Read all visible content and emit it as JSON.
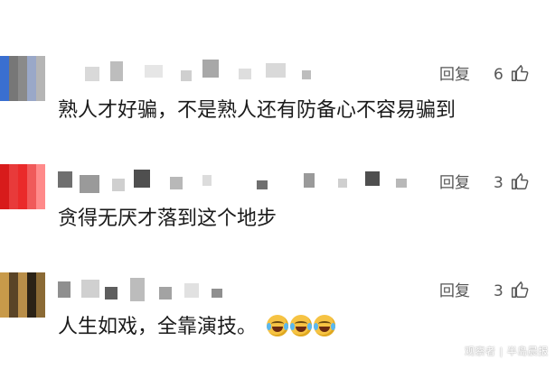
{
  "comments": [
    {
      "text": "熟人才好骗，不是熟人还有防备心不容易骗到",
      "reply_label": "回复",
      "likes": "6",
      "avatar_colors": [
        "#3a6fd0",
        "#9aa8c8",
        "#c9c9c9",
        "#777",
        "#b5b5b5",
        "#d8d8d8",
        "#8a8a8a",
        "#e5e5e5"
      ],
      "name_mosaic_colors": [
        "#d9d9d9",
        "#bdbdbd",
        "#e6e6e6",
        "#cfcfcf",
        "#a8a8a8",
        "#dedede"
      ]
    },
    {
      "text": "贪得无厌才落到这个地步",
      "reply_label": "回复",
      "likes": "3",
      "avatar_colors": [
        "#d81b1b",
        "#f05a5a",
        "#b51212",
        "#e83a3a",
        "#ff8a8a",
        "#c21c1c",
        "#ea2a2a",
        "#a50f0f"
      ],
      "name_mosaic_colors": [
        "#6f6f6f",
        "#9a9a9a",
        "#cfcfcf",
        "#4f4f4f",
        "#b8b8b8",
        "#dcdcdc"
      ]
    },
    {
      "text": "人生如戏，全靠演技。",
      "reply_label": "回复",
      "likes": "3",
      "emoji": "laugh-cry",
      "emoji_count": 3,
      "avatar_colors": [
        "#c89a4a",
        "#2b2216",
        "#e0b86a",
        "#5a4427",
        "#8b6a35",
        "#1e170e",
        "#b98e49",
        "#3e2f1b"
      ],
      "name_mosaic_colors": [
        "#8f8f8f",
        "#d0d0d0",
        "#5e5e5e",
        "#bcbcbc",
        "#a3a3a3",
        "#e1e1e1"
      ]
    }
  ],
  "watermark": "观察者 | 半岛晨报"
}
